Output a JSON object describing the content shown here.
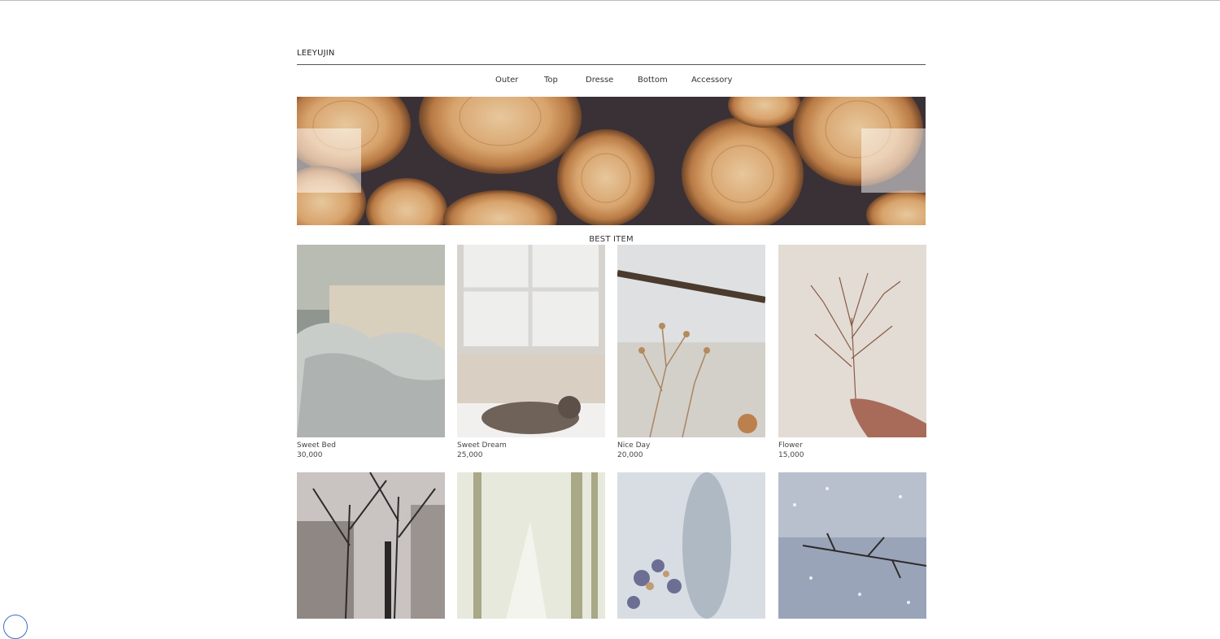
{
  "brand": {
    "logo": "LEEYUJIN"
  },
  "nav": {
    "items": [
      {
        "label": "Outer"
      },
      {
        "label": "Top"
      },
      {
        "label": "Dresse"
      },
      {
        "label": "Bottom"
      },
      {
        "label": "Accessory"
      }
    ]
  },
  "banner": {
    "image": "stacked-firewood-logs",
    "prev_icon": "prev-slide-icon",
    "next_icon": "next-slide-icon"
  },
  "best": {
    "title": "BEST ITEM",
    "items": [
      {
        "name": "Sweet Bed",
        "price": "30,000",
        "image": "bed-photo"
      },
      {
        "name": "Sweet Dream",
        "price": "25,000",
        "image": "cat-window-photo"
      },
      {
        "name": "Nice Day",
        "price": "20,000",
        "image": "dried-flowers-photo"
      },
      {
        "name": "Flower",
        "price": "15,000",
        "image": "hand-holding-branch-photo"
      },
      {
        "name": "",
        "price": "",
        "image": "winter-city-trees-photo"
      },
      {
        "name": "",
        "price": "",
        "image": "snowy-forest-path-photo"
      },
      {
        "name": "",
        "price": "",
        "image": "blurred-flowers-photo"
      },
      {
        "name": "",
        "price": "",
        "image": "snowy-branch-photo"
      }
    ]
  }
}
